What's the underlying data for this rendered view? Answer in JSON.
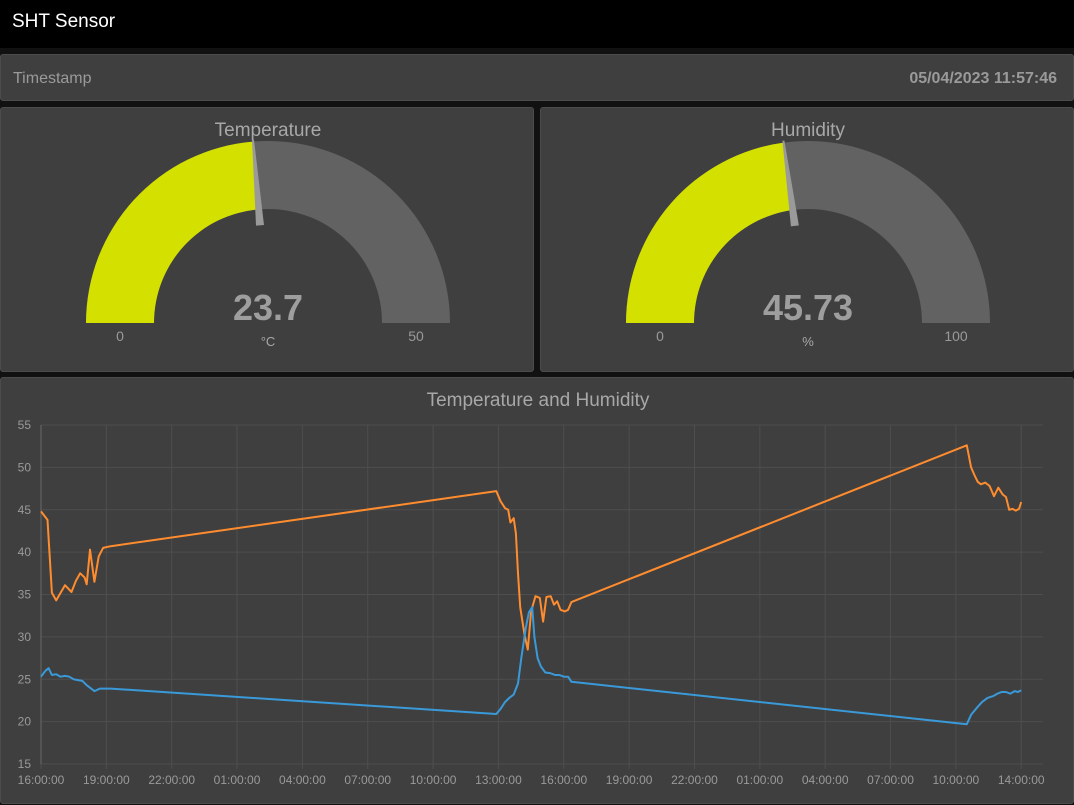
{
  "app": {
    "title": "SHT Sensor"
  },
  "timestamp": {
    "label": "Timestamp",
    "value": "05/04/2023 11:57:46"
  },
  "gauges": [
    {
      "title": "Temperature",
      "value_text": "23.7",
      "value": 23.7,
      "unit": "°C",
      "min": 0,
      "max": 50,
      "min_label": "0",
      "max_label": "50",
      "color": "#d4e000"
    },
    {
      "title": "Humidity",
      "value_text": "45.73",
      "value": 45.73,
      "unit": "%",
      "min": 0,
      "max": 100,
      "min_label": "0",
      "max_label": "100",
      "color": "#d4e000"
    }
  ],
  "colors": {
    "gauge_track": "#626262",
    "needle": "#9a9a9a",
    "humidity_series": "#ff8c2e",
    "temperature_series": "#3a9ad9",
    "grid": "#4e4e4e"
  },
  "chart_data": {
    "type": "line",
    "title": "Temperature and Humidity",
    "xlabel": "",
    "ylabel": "",
    "ylim": [
      15,
      55
    ],
    "y_ticks": [
      15,
      20,
      25,
      30,
      35,
      40,
      45,
      50,
      55
    ],
    "x_ticks": [
      {
        "t": 0,
        "label": "16:00:00"
      },
      {
        "t": 3,
        "label": "19:00:00"
      },
      {
        "t": 6,
        "label": "22:00:00"
      },
      {
        "t": 9,
        "label": "01:00:00"
      },
      {
        "t": 12,
        "label": "04:00:00"
      },
      {
        "t": 15,
        "label": "07:00:00"
      },
      {
        "t": 18,
        "label": "10:00:00"
      },
      {
        "t": 21,
        "label": "13:00:00"
      },
      {
        "t": 24,
        "label": "16:00:00"
      },
      {
        "t": 27,
        "label": "19:00:00"
      },
      {
        "t": 30,
        "label": "22:00:00"
      },
      {
        "t": 33,
        "label": "01:00:00"
      },
      {
        "t": 36,
        "label": "04:00:00"
      },
      {
        "t": 39,
        "label": "07:00:00"
      },
      {
        "t": 42,
        "label": "10:00:00"
      },
      {
        "t": 45,
        "label": "14:00:00"
      }
    ],
    "x_range": [
      0,
      46
    ],
    "series": [
      {
        "color": "#ff8c2e",
        "points": [
          [
            0,
            44.8
          ],
          [
            0.3,
            43.8
          ],
          [
            0.5,
            35.2
          ],
          [
            0.7,
            34.3
          ],
          [
            0.9,
            35.2
          ],
          [
            1.1,
            36.1
          ],
          [
            1.4,
            35.3
          ],
          [
            1.6,
            36.6
          ],
          [
            1.8,
            37.5
          ],
          [
            2.0,
            37.0
          ],
          [
            2.1,
            36.2
          ],
          [
            2.25,
            40.3
          ],
          [
            2.45,
            36.5
          ],
          [
            2.65,
            39.5
          ],
          [
            2.85,
            40.5
          ],
          [
            3.2,
            40.7
          ],
          [
            20.9,
            47.2
          ],
          [
            21.1,
            46.0
          ],
          [
            21.3,
            45.2
          ],
          [
            21.45,
            45.0
          ],
          [
            21.55,
            43.5
          ],
          [
            21.7,
            44.0
          ],
          [
            21.8,
            42.2
          ],
          [
            21.9,
            37.5
          ],
          [
            22.0,
            33.5
          ],
          [
            22.2,
            30.2
          ],
          [
            22.35,
            28.5
          ],
          [
            22.5,
            33.0
          ],
          [
            22.7,
            34.8
          ],
          [
            22.9,
            34.6
          ],
          [
            23.05,
            31.8
          ],
          [
            23.2,
            34.7
          ],
          [
            23.4,
            34.8
          ],
          [
            23.55,
            33.8
          ],
          [
            23.7,
            34.2
          ],
          [
            23.85,
            33.2
          ],
          [
            24.05,
            33.0
          ],
          [
            24.2,
            33.2
          ],
          [
            24.35,
            34.1
          ],
          [
            42.5,
            52.6
          ],
          [
            42.7,
            50.0
          ],
          [
            42.85,
            49.1
          ],
          [
            43.0,
            48.3
          ],
          [
            43.15,
            48.0
          ],
          [
            43.35,
            48.2
          ],
          [
            43.55,
            47.8
          ],
          [
            43.75,
            46.6
          ],
          [
            43.95,
            47.6
          ],
          [
            44.15,
            46.8
          ],
          [
            44.3,
            46.5
          ],
          [
            44.45,
            45.0
          ],
          [
            44.6,
            45.1
          ],
          [
            44.75,
            44.9
          ],
          [
            44.9,
            45.1
          ],
          [
            45.0,
            45.9
          ]
        ]
      },
      {
        "color": "#3a9ad9",
        "points": [
          [
            0,
            25.3
          ],
          [
            0.2,
            26.0
          ],
          [
            0.35,
            26.3
          ],
          [
            0.5,
            25.5
          ],
          [
            0.7,
            25.6
          ],
          [
            0.9,
            25.3
          ],
          [
            1.1,
            25.4
          ],
          [
            1.3,
            25.3
          ],
          [
            1.5,
            25.0
          ],
          [
            1.7,
            24.9
          ],
          [
            1.9,
            24.8
          ],
          [
            2.1,
            24.3
          ],
          [
            2.3,
            23.9
          ],
          [
            2.45,
            23.6
          ],
          [
            2.7,
            23.9
          ],
          [
            3.2,
            23.9
          ],
          [
            20.9,
            20.9
          ],
          [
            21.1,
            21.5
          ],
          [
            21.3,
            22.3
          ],
          [
            21.5,
            22.8
          ],
          [
            21.7,
            23.2
          ],
          [
            21.9,
            24.5
          ],
          [
            22.05,
            27.5
          ],
          [
            22.25,
            31.0
          ],
          [
            22.4,
            32.9
          ],
          [
            22.55,
            33.5
          ],
          [
            22.65,
            30.0
          ],
          [
            22.8,
            27.5
          ],
          [
            22.95,
            26.5
          ],
          [
            23.15,
            25.8
          ],
          [
            23.4,
            25.7
          ],
          [
            23.6,
            25.5
          ],
          [
            23.8,
            25.5
          ],
          [
            24.0,
            25.3
          ],
          [
            24.2,
            25.3
          ],
          [
            24.35,
            24.7
          ],
          [
            42.5,
            19.7
          ],
          [
            42.7,
            20.8
          ],
          [
            42.95,
            21.6
          ],
          [
            43.2,
            22.3
          ],
          [
            43.45,
            22.8
          ],
          [
            43.7,
            23.0
          ],
          [
            43.9,
            23.3
          ],
          [
            44.1,
            23.5
          ],
          [
            44.3,
            23.5
          ],
          [
            44.5,
            23.3
          ],
          [
            44.7,
            23.6
          ],
          [
            44.85,
            23.5
          ],
          [
            45.0,
            23.7
          ]
        ]
      }
    ]
  }
}
